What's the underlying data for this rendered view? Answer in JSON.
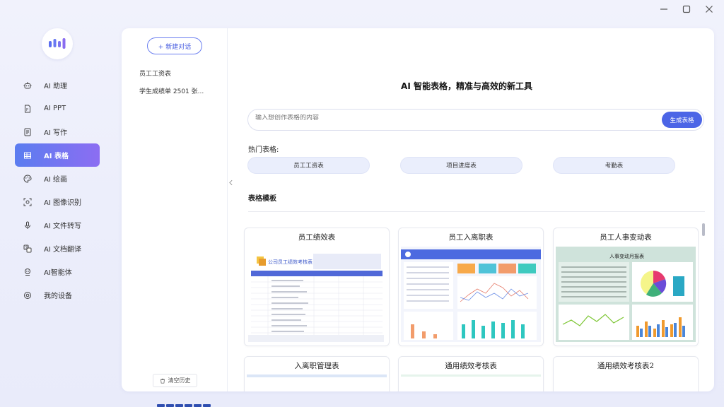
{
  "window": {
    "minimize": "minimize",
    "maximize": "maximize",
    "close": "close"
  },
  "nav": {
    "items": [
      {
        "label": "AI 助理",
        "icon": "robot-icon"
      },
      {
        "label": "AI PPT",
        "icon": "ppt-file-icon"
      },
      {
        "label": "AI 写作",
        "icon": "document-icon"
      },
      {
        "label": "AI 表格",
        "icon": "table-icon",
        "active": true
      },
      {
        "label": "AI 绘画",
        "icon": "palette-icon"
      },
      {
        "label": "AI 图像识别",
        "icon": "scan-image-icon"
      },
      {
        "label": "AI 文件转写",
        "icon": "transcribe-icon"
      },
      {
        "label": "AI 文档翻译",
        "icon": "translate-icon"
      },
      {
        "label": "AI智能体",
        "icon": "agent-icon"
      },
      {
        "label": "我的设备",
        "icon": "device-icon"
      }
    ]
  },
  "history": {
    "new_chat": "+ 新建对话",
    "items": [
      "员工工资表",
      "学生成绩单 2501 张..."
    ],
    "clear": "清空历史"
  },
  "main": {
    "headline": "AI 智能表格，精准与高效的新工具",
    "search_placeholder": "输入想创作表格的内容",
    "generate": "生成表格",
    "hot_title": "热门表格:",
    "hot_tags": [
      "员工工资表",
      "项目进度表",
      "考勤表"
    ],
    "templates_title": "表格模板",
    "templates": [
      {
        "title": "员工绩效表",
        "thumb_title": "公司员工绩效考核表"
      },
      {
        "title": "员工入离职表"
      },
      {
        "title": "员工人事变动表",
        "thumb_title": "人事变动月报表"
      },
      {
        "title": "入离职管理表"
      },
      {
        "title": "通用绩效考核表"
      },
      {
        "title": "通用绩效考核表2"
      }
    ]
  },
  "colors": {
    "accent": "#4c65e6",
    "nav_active_from": "#5b7df0",
    "nav_active_to": "#8c6df2"
  }
}
